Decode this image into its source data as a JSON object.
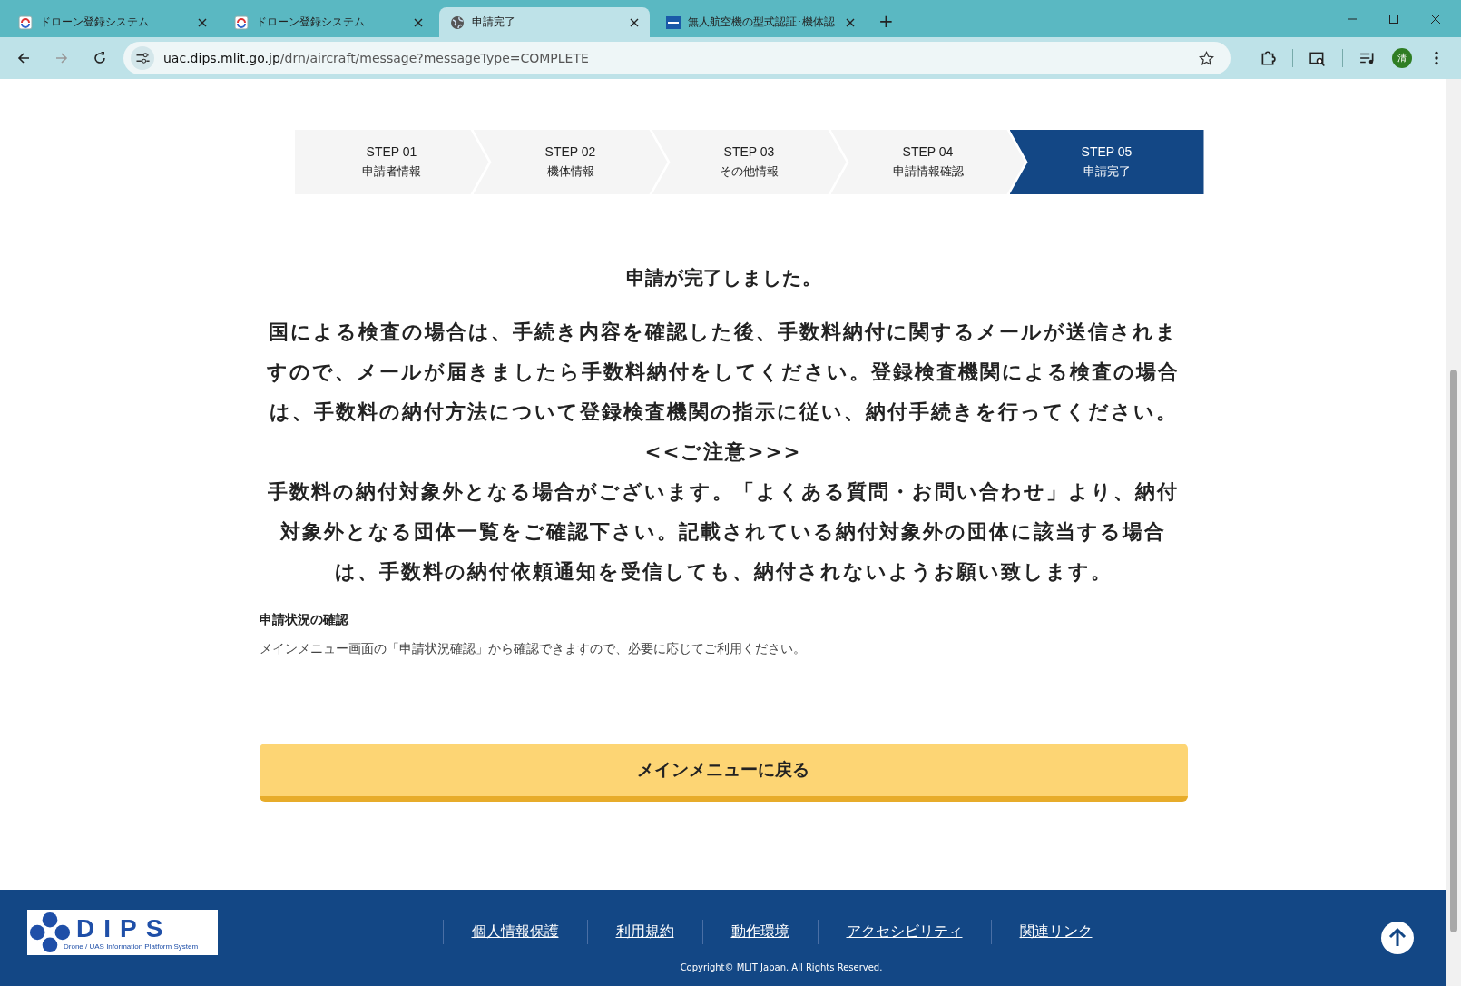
{
  "browser": {
    "tabs": [
      {
        "title": "ドローン登録システム",
        "kind": "app",
        "selected": false
      },
      {
        "title": "ドローン登録システム",
        "kind": "app",
        "selected": false
      },
      {
        "title": "申請完了",
        "kind": "web",
        "selected": true
      },
      {
        "title": "無人航空機の型式認証･機体認",
        "kind": "site",
        "selected": false
      }
    ],
    "new_tab": "+",
    "url_host": "uac.dips.mlit.go.jp",
    "url_path": "/drn/aircraft/message?messageType=COMPLETE",
    "avatar": "清"
  },
  "steps": [
    {
      "number": "STEP 01",
      "label": "申請者情報",
      "selected": false
    },
    {
      "number": "STEP 02",
      "label": "機体情報",
      "selected": false
    },
    {
      "number": "STEP 03",
      "label": "その他情報",
      "selected": false
    },
    {
      "number": "STEP 04",
      "label": "申請情報確認",
      "selected": false
    },
    {
      "number": "STEP 05",
      "label": "申請完了",
      "selected": true
    }
  ],
  "message": {
    "title": "申請が完了しました。",
    "paragraphs": [
      "国による検査の場合は、手続き内容を確認した後、手数料納付に関するメールが送信されますので、メールが届きましたら手数料納付をしてください。登録検査機関による検査の場合は、手数料の納付方法について登録検査機関の指示に従い、納付手続きを行ってください。",
      "<<ご注意>>>",
      "手数料の納付対象外となる場合がございます。「よくある質問・お問い合わせ」より、納付対象外となる団体一覧をご確認下さい。記載されている納付対象外の団体に該当する場合は、手数料の納付依頼通知を受信しても、納付されないようお願い致します。"
    ]
  },
  "status_section": {
    "heading": "申請状況の確認",
    "text": "メインメニュー画面の「申請状況確認」から確認できますので、必要に応じてご利用ください。"
  },
  "main_button": "メインメニューに戻る",
  "footer": {
    "logo_text": "DIPS",
    "logo_subtitle": "Drone / UAS Information Platform System",
    "links": [
      "個人情報保護",
      "利用規約",
      "動作環境",
      "アクセシビリティ",
      "関連リンク"
    ],
    "copyright": "Copyright© MLIT Japan. All Rights Reserved."
  }
}
